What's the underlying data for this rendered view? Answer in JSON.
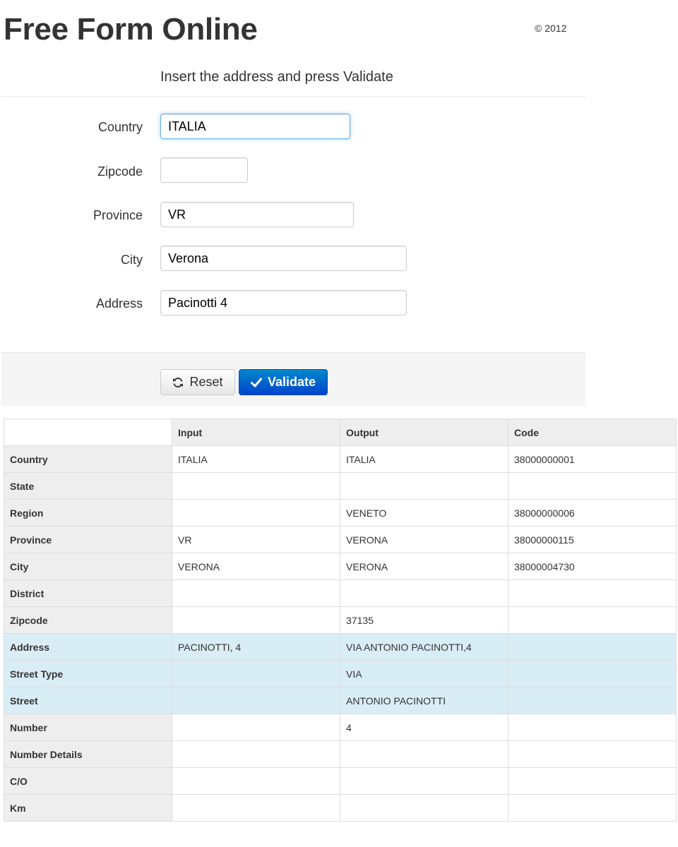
{
  "header": {
    "title": "Free Form Online",
    "copyright": "© 2012"
  },
  "form": {
    "legend": "Insert the address and press Validate",
    "fields": {
      "country": {
        "label": "Country",
        "value": "ITALIA"
      },
      "zipcode": {
        "label": "Zipcode",
        "value": ""
      },
      "province": {
        "label": "Province",
        "value": "VR"
      },
      "city": {
        "label": "City",
        "value": "Verona"
      },
      "address": {
        "label": "Address",
        "value": "Pacinotti 4"
      }
    },
    "buttons": {
      "reset": "Reset",
      "validate": "Validate"
    }
  },
  "colors": {
    "primary_button": "#0055cc",
    "info_row": "#d9edf7",
    "header_cell": "#eeeeee"
  },
  "results": {
    "columns": [
      "",
      "Input",
      "Output",
      "Code"
    ],
    "rows": [
      {
        "label": "Country",
        "input": "ITALIA",
        "output": "ITALIA",
        "code": "38000000001",
        "highlight": false
      },
      {
        "label": "State",
        "input": "",
        "output": "",
        "code": "",
        "highlight": false
      },
      {
        "label": "Region",
        "input": "",
        "output": "VENETO",
        "code": "38000000006",
        "highlight": false
      },
      {
        "label": "Province",
        "input": "VR",
        "output": "VERONA",
        "code": "38000000115",
        "highlight": false
      },
      {
        "label": "City",
        "input": "VERONA",
        "output": "VERONA",
        "code": "38000004730",
        "highlight": false
      },
      {
        "label": "District",
        "input": "",
        "output": "",
        "code": "",
        "highlight": false
      },
      {
        "label": "Zipcode",
        "input": "",
        "output": "37135",
        "code": "",
        "highlight": false
      },
      {
        "label": "Address",
        "input": "PACINOTTI, 4",
        "output": "VIA ANTONIO PACINOTTI,4",
        "code": "",
        "highlight": true
      },
      {
        "label": "Street Type",
        "input": "",
        "output": "VIA",
        "code": "",
        "highlight": true
      },
      {
        "label": "Street",
        "input": "",
        "output": "ANTONIO PACINOTTI",
        "code": "",
        "highlight": true
      },
      {
        "label": "Number",
        "input": "",
        "output": "4",
        "code": "",
        "highlight": false
      },
      {
        "label": "Number Details",
        "input": "",
        "output": "",
        "code": "",
        "highlight": false
      },
      {
        "label": "C/O",
        "input": "",
        "output": "",
        "code": "",
        "highlight": false
      },
      {
        "label": "Km",
        "input": "",
        "output": "",
        "code": "",
        "highlight": false
      }
    ]
  }
}
